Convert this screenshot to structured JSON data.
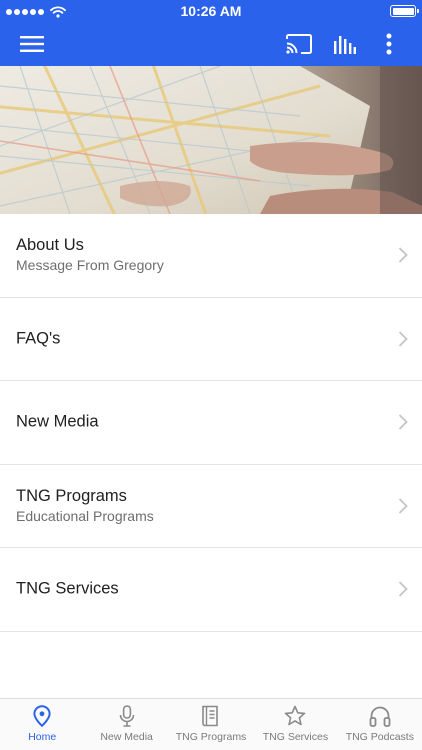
{
  "status_bar": {
    "time": "10:26 AM"
  },
  "colors": {
    "brand": "#2b62ec",
    "tab_inactive": "#7a7a7a",
    "divider": "#e2e2e2"
  },
  "app_bar": {
    "icons": [
      "menu-icon",
      "cast-icon",
      "equalizer-icon",
      "more-vert-icon"
    ]
  },
  "hero": {
    "image": "hand-holding-city-map"
  },
  "menu": {
    "items": [
      {
        "title": "About Us",
        "subtitle": "Message From Gregory"
      },
      {
        "title": "FAQ's",
        "subtitle": ""
      },
      {
        "title": "New Media",
        "subtitle": ""
      },
      {
        "title": "TNG Programs",
        "subtitle": "Educational Programs"
      },
      {
        "title": "TNG Services",
        "subtitle": ""
      }
    ]
  },
  "tabs": [
    {
      "label": "Home",
      "icon": "location-pin-icon",
      "active": true
    },
    {
      "label": "New Media",
      "icon": "microphone-icon",
      "active": false
    },
    {
      "label": "TNG Programs",
      "icon": "book-icon",
      "active": false
    },
    {
      "label": "TNG Services",
      "icon": "star-icon",
      "active": false
    },
    {
      "label": "TNG Podcasts",
      "icon": "headphones-icon",
      "active": false
    }
  ]
}
